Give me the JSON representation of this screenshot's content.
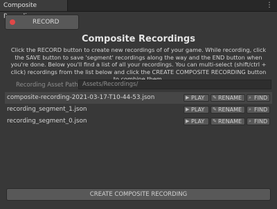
{
  "tab": {
    "title": "Composite Recordings",
    "menu_icon": "kebab-menu-icon"
  },
  "record_button": {
    "label": "RECORD",
    "icon": "record-dot-icon",
    "icon_color": "#e04848"
  },
  "title": "Composite Recordings",
  "description": "Click the RECORD button to create new recordings of of your game.  While recording, click the SAVE button to save 'segment' recordings along the way and the END button when you're done.  Below you'll find a list of all your recordings.  You can multi-select (shift/ctrl + click) recordings from the list below and click the CREATE COMPOSITE RECORDING button to combine them.",
  "asset_path": {
    "label": "Recording Asset Path",
    "value": "Assets/Recordings/"
  },
  "recordings": [
    {
      "name": "composite-recording-2021-03-17-T10-44-53.json",
      "selected": true
    },
    {
      "name": "recording_segment_1.json",
      "selected": false
    },
    {
      "name": "recording_segment_0.json",
      "selected": false
    }
  ],
  "row_buttons": {
    "play": {
      "label": "PLAY",
      "icon": "play-icon"
    },
    "rename": {
      "label": "RENAME",
      "icon": "pencil-icon"
    },
    "find": {
      "label": "FIND",
      "icon": "search-icon"
    }
  },
  "create_button": {
    "label": "CREATE COMPOSITE RECORDING"
  }
}
